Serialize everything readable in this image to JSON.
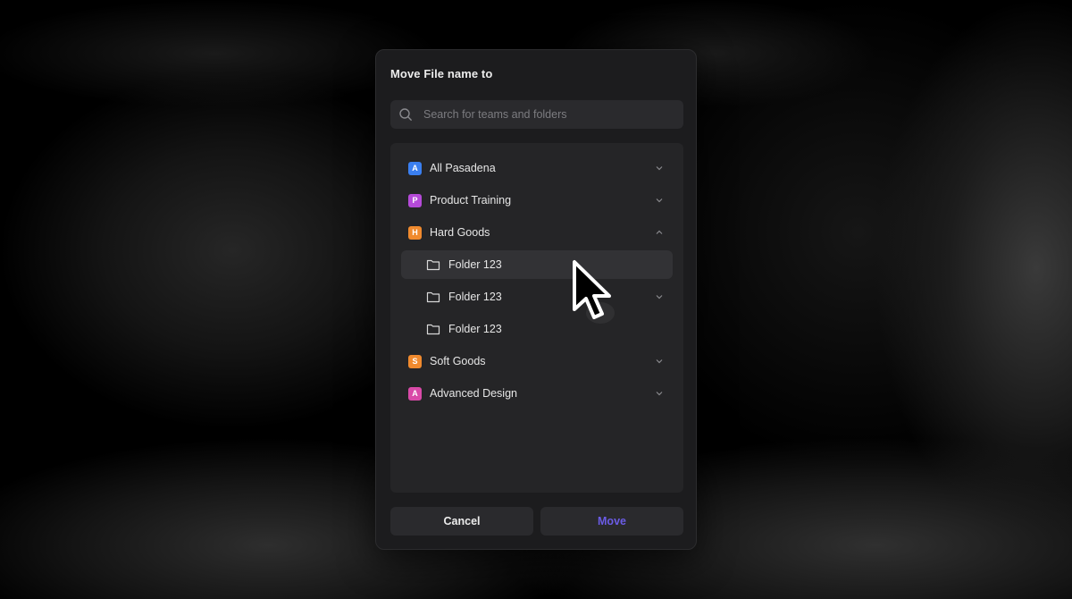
{
  "modal": {
    "title": "Move File name to",
    "search_placeholder": "Search for teams and folders",
    "items": [
      {
        "badge": "A",
        "label": "All Pasadena",
        "color": "#3a7ff0",
        "chevron": "chevron-down-icon"
      },
      {
        "badge": "P",
        "label": "Product Training",
        "color": "#b54ad8",
        "chevron": "chevron-down-icon"
      },
      {
        "badge": "H",
        "label": "Hard Goods",
        "color": "#f08a2e",
        "chevron": "chevron-up-icon"
      },
      {
        "label": "Folder 123",
        "icon": "folder-icon",
        "selected": true
      },
      {
        "label": "Folder 123",
        "icon": "folder-icon",
        "chevron": "chevron-down-icon"
      },
      {
        "label": "Folder 123",
        "icon": "folder-icon"
      },
      {
        "badge": "S",
        "label": "Soft Goods",
        "color": "#f08a2e",
        "chevron": "chevron-down-icon"
      },
      {
        "badge": "A",
        "label": "Advanced Design",
        "color": "#d94aa8",
        "chevron": "chevron-down-icon"
      }
    ],
    "cancel_label": "Cancel",
    "move_label": "Move",
    "move_color": "#6b5ce6"
  }
}
